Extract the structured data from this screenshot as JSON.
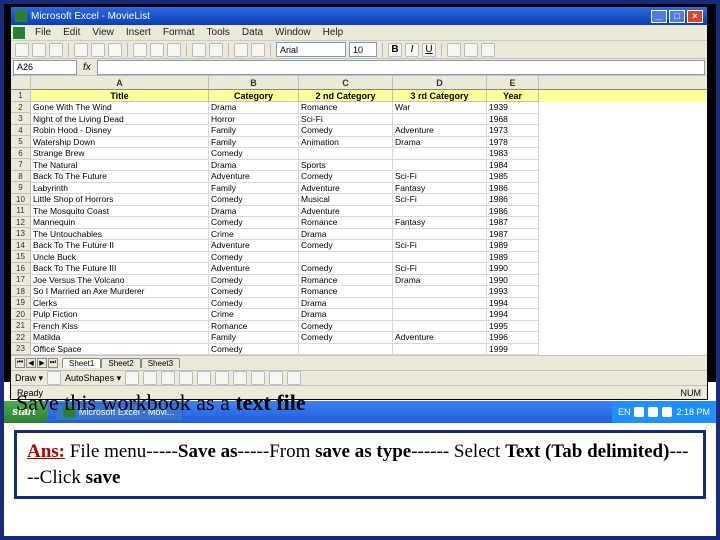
{
  "window": {
    "title": "Microsoft Excel - MovieList",
    "win_min": "_",
    "win_max": "□",
    "win_close": "×"
  },
  "menu": [
    "File",
    "Edit",
    "View",
    "Insert",
    "Format",
    "Tools",
    "Data",
    "Window",
    "Help"
  ],
  "toolbar": {
    "font": "Arial",
    "fontsize": "10",
    "bold": "B",
    "italic": "I",
    "underline": "U"
  },
  "namebox": "A26",
  "headers": {
    "A": "A",
    "B": "B",
    "C": "C",
    "D": "D",
    "E": "E"
  },
  "colheaders": {
    "title": "Title",
    "cat": "Category",
    "cat2": "2 nd Category",
    "cat3": "3 rd Category",
    "year": "Year"
  },
  "rows": [
    {
      "n": "2",
      "a": "Gone With The Wind",
      "b": "Drama",
      "c": "Romance",
      "d": "War",
      "e": "1939"
    },
    {
      "n": "3",
      "a": "Night of the Living Dead",
      "b": "Horror",
      "c": "Sci-Fi",
      "d": "",
      "e": "1968"
    },
    {
      "n": "4",
      "a": "Robin Hood - Disney",
      "b": "Family",
      "c": "Comedy",
      "d": "Adventure",
      "e": "1973"
    },
    {
      "n": "5",
      "a": "Watership Down",
      "b": "Family",
      "c": "Animation",
      "d": "Drama",
      "e": "1978"
    },
    {
      "n": "6",
      "a": "Strange Brew",
      "b": "Comedy",
      "c": "",
      "d": "",
      "e": "1983"
    },
    {
      "n": "7",
      "a": "The Natural",
      "b": "Drama",
      "c": "Sports",
      "d": "",
      "e": "1984"
    },
    {
      "n": "8",
      "a": "Back To The Future",
      "b": "Adventure",
      "c": "Comedy",
      "d": "Sci-Fi",
      "e": "1985"
    },
    {
      "n": "9",
      "a": "Labyrinth",
      "b": "Family",
      "c": "Adventure",
      "d": "Fantasy",
      "e": "1986"
    },
    {
      "n": "10",
      "a": "Little Shop of Horrors",
      "b": "Comedy",
      "c": "Musical",
      "d": "Sci-Fi",
      "e": "1986"
    },
    {
      "n": "11",
      "a": "The Mosquito Coast",
      "b": "Drama",
      "c": "Adventure",
      "d": "",
      "e": "1986"
    },
    {
      "n": "12",
      "a": "Mannequin",
      "b": "Comedy",
      "c": "Romance",
      "d": "Fantasy",
      "e": "1987"
    },
    {
      "n": "13",
      "a": "The Untouchables",
      "b": "Crime",
      "c": "Drama",
      "d": "",
      "e": "1987"
    },
    {
      "n": "14",
      "a": "Back To The Future II",
      "b": "Adventure",
      "c": "Comedy",
      "d": "Sci-Fi",
      "e": "1989"
    },
    {
      "n": "15",
      "a": "Uncle Buck",
      "b": "Comedy",
      "c": "",
      "d": "",
      "e": "1989"
    },
    {
      "n": "16",
      "a": "Back To The Future III",
      "b": "Adventure",
      "c": "Comedy",
      "d": "Sci-Fi",
      "e": "1990"
    },
    {
      "n": "17",
      "a": "Joe Versus The Volcano",
      "b": "Comedy",
      "c": "Romance",
      "d": "Drama",
      "e": "1990"
    },
    {
      "n": "18",
      "a": "So I Married an Axe Murderer",
      "b": "Comedy",
      "c": "Romance",
      "d": "",
      "e": "1993"
    },
    {
      "n": "19",
      "a": "Clerks",
      "b": "Comedy",
      "c": "Drama",
      "d": "",
      "e": "1994"
    },
    {
      "n": "20",
      "a": "Pulp Fiction",
      "b": "Crime",
      "c": "Drama",
      "d": "",
      "e": "1994"
    },
    {
      "n": "21",
      "a": "French Kiss",
      "b": "Romance",
      "c": "Comedy",
      "d": "",
      "e": "1995"
    },
    {
      "n": "22",
      "a": "Matilda",
      "b": "Family",
      "c": "Comedy",
      "d": "Adventure",
      "e": "1996"
    },
    {
      "n": "23",
      "a": "Office Space",
      "b": "Comedy",
      "c": "",
      "d": "",
      "e": "1999"
    }
  ],
  "sheets": {
    "s1": "Sheet1",
    "s2": "Sheet2",
    "s3": "Sheet3"
  },
  "draw": {
    "label": "Draw ▾",
    "autoshapes": "AutoShapes ▾"
  },
  "status": {
    "ready": "Ready",
    "num": "NUM"
  },
  "taskbar": {
    "start": "start",
    "task": "Microsoft Excel - Movi...",
    "lang": "EN",
    "time": "2:18 PM"
  },
  "question": {
    "pre": "Save this workbook as a ",
    "bold": "text file"
  },
  "answer": {
    "label": "Ans:",
    "t1": " File menu-----",
    "b1": "Save as",
    "t2": "-----From ",
    "b2": "save as type",
    "t3": "------ Select ",
    "b3": "Text (Tab delimited)",
    "t4": "-----Click ",
    "b4": "save"
  }
}
